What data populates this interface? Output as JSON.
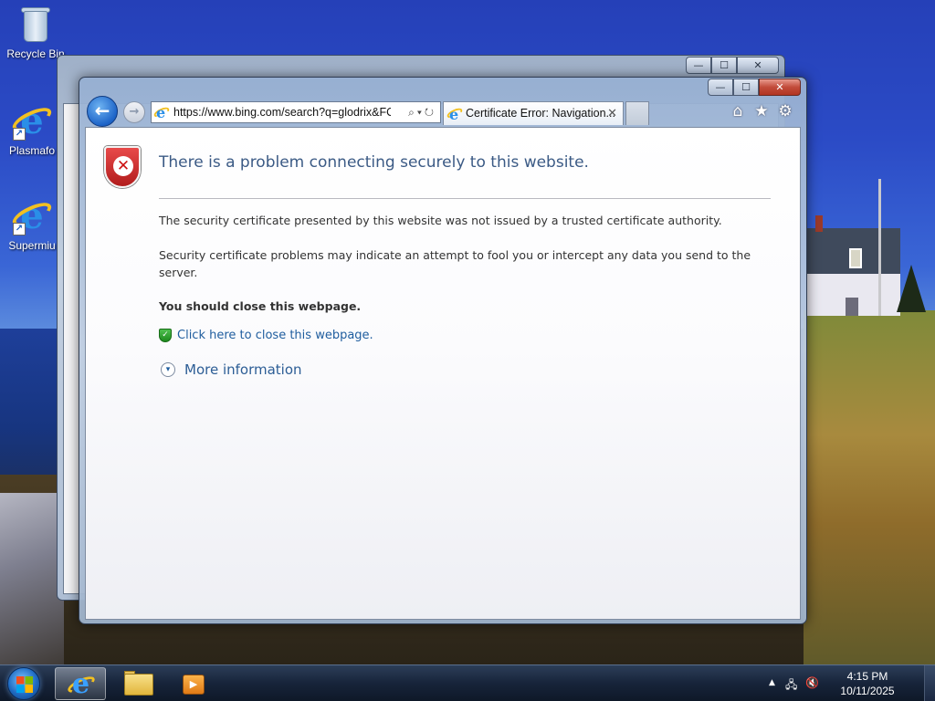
{
  "desktop": {
    "icons": [
      {
        "label": "Recycle Bin",
        "icon": "recycle-bin-icon"
      },
      {
        "label": "Plasmafo",
        "icon": "internet-explorer-icon"
      },
      {
        "label": "Supermiu",
        "icon": "internet-explorer-icon"
      }
    ]
  },
  "background_window": {
    "controls": {
      "minimize": "—",
      "maximize": "☐",
      "close": "✕"
    }
  },
  "browser": {
    "controls": {
      "minimize": "—",
      "maximize": "☐",
      "close": "✕"
    },
    "nav": {
      "back": "←",
      "forward": "→"
    },
    "address": {
      "url": "https://www.bing.com/search?q=glodrix&FO",
      "search_glyph": "⌕",
      "dropdown_glyph": "▾",
      "refresh_glyph": "↻"
    },
    "tabs": [
      {
        "title": "Certificate Error: Navigation...",
        "close": "✕",
        "icon": "internet-explorer-icon"
      }
    ],
    "command_icons": [
      {
        "name": "home-icon",
        "glyph": "⌂"
      },
      {
        "name": "favorites-star-icon",
        "glyph": "★"
      },
      {
        "name": "settings-gear-icon",
        "glyph": "⚙"
      }
    ]
  },
  "page": {
    "title": "There is a problem connecting securely to this website.",
    "paragraph1": "The security certificate presented by this website was not issued by a trusted certificate authority.",
    "paragraph2": "Security certificate problems may indicate an attempt to fool you or intercept any data you send to the server.",
    "recommendation": "You should close this webpage.",
    "close_link": "Click here to close this webpage.",
    "more_info": "More information",
    "shield_glyph": "✕",
    "check_glyph": "✓",
    "chevron_glyph": "▾"
  },
  "taskbar": {
    "items": [
      {
        "name": "internet-explorer",
        "active": true
      },
      {
        "name": "file-explorer",
        "active": false
      },
      {
        "name": "media-player",
        "active": false
      }
    ],
    "tray": {
      "arrow_glyph": "▲",
      "network_glyph": "🖧",
      "volume_glyph": "🔇"
    },
    "clock": {
      "time": "4:15 PM",
      "date": "10/11/2025"
    }
  }
}
